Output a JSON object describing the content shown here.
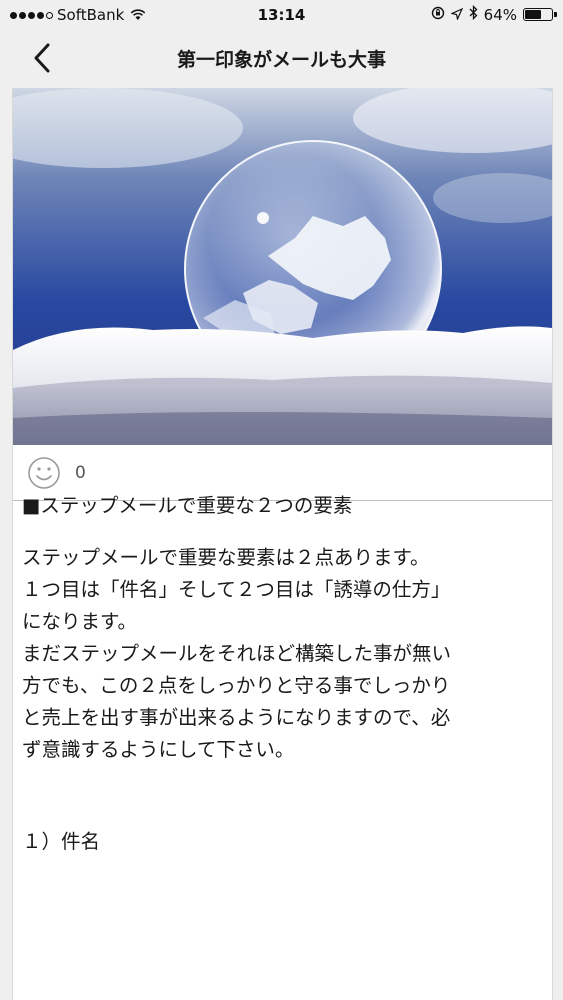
{
  "status_bar": {
    "carrier": "SoftBank",
    "time": "13:14",
    "battery": "64%",
    "battery_level": 0.64
  },
  "nav": {
    "title": "第一印象がメールも大事"
  },
  "reactions": {
    "count": "0"
  },
  "article": {
    "heading": "■ステップメールで重要な２つの要素",
    "paragraph_lines": [
      "ステップメールで重要な要素は２点あります。",
      "１つ目は「件名」そして２つ目は「誘導の仕方」",
      "になります。",
      "まだステップメールをそれほど構築した事が無い",
      "方でも、この２点をしっかりと守る事でしっかり",
      "と売上を出す事が出来るようになりますので、必",
      "ず意識するようにして下さい。"
    ],
    "subheading": "１）件名"
  }
}
